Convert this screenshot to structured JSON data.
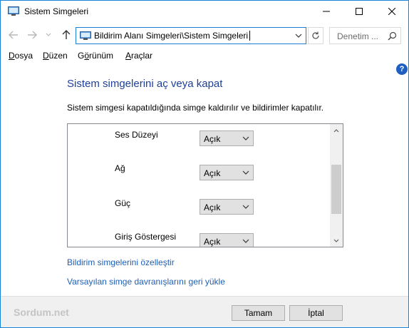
{
  "window": {
    "title": "Sistem Simgeleri"
  },
  "address_bar": {
    "path": "Bildirim Alanı Simgeleri\\Sistem Simgeleri",
    "search_placeholder": "Denetim ..."
  },
  "menu": {
    "items": [
      {
        "underline": "D",
        "rest": "osya"
      },
      {
        "underline": "D",
        "rest": "üzen"
      },
      {
        "pre": "G",
        "underline": "ö",
        "rest": "rünüm"
      },
      {
        "underline": "A",
        "rest": "raçlar"
      }
    ]
  },
  "main": {
    "heading": "Sistem simgelerini aç veya kapat",
    "description": "Sistem simgesi kapatıldığında simge kaldırılır ve bildirimler kapatılır.",
    "icons": [
      {
        "label": "Ses Düzeyi",
        "value": "Açık"
      },
      {
        "label": "Ağ",
        "value": "Açık"
      },
      {
        "label": "Güç",
        "value": "Açık"
      },
      {
        "label": "Giriş Göstergesi",
        "value": "Açık"
      }
    ],
    "links": {
      "customize": "Bildirim simgelerini özelleştir",
      "restore": "Varsayılan simge davranışlarını geri yükle"
    }
  },
  "footer": {
    "brand": "Sordum.net",
    "ok_label": "Tamam",
    "cancel_label": "İptal"
  },
  "colors": {
    "heading": "#1e3f9b",
    "link": "#1e5fb3",
    "window_border": "#1883d7",
    "help": "#1f5fc1"
  }
}
